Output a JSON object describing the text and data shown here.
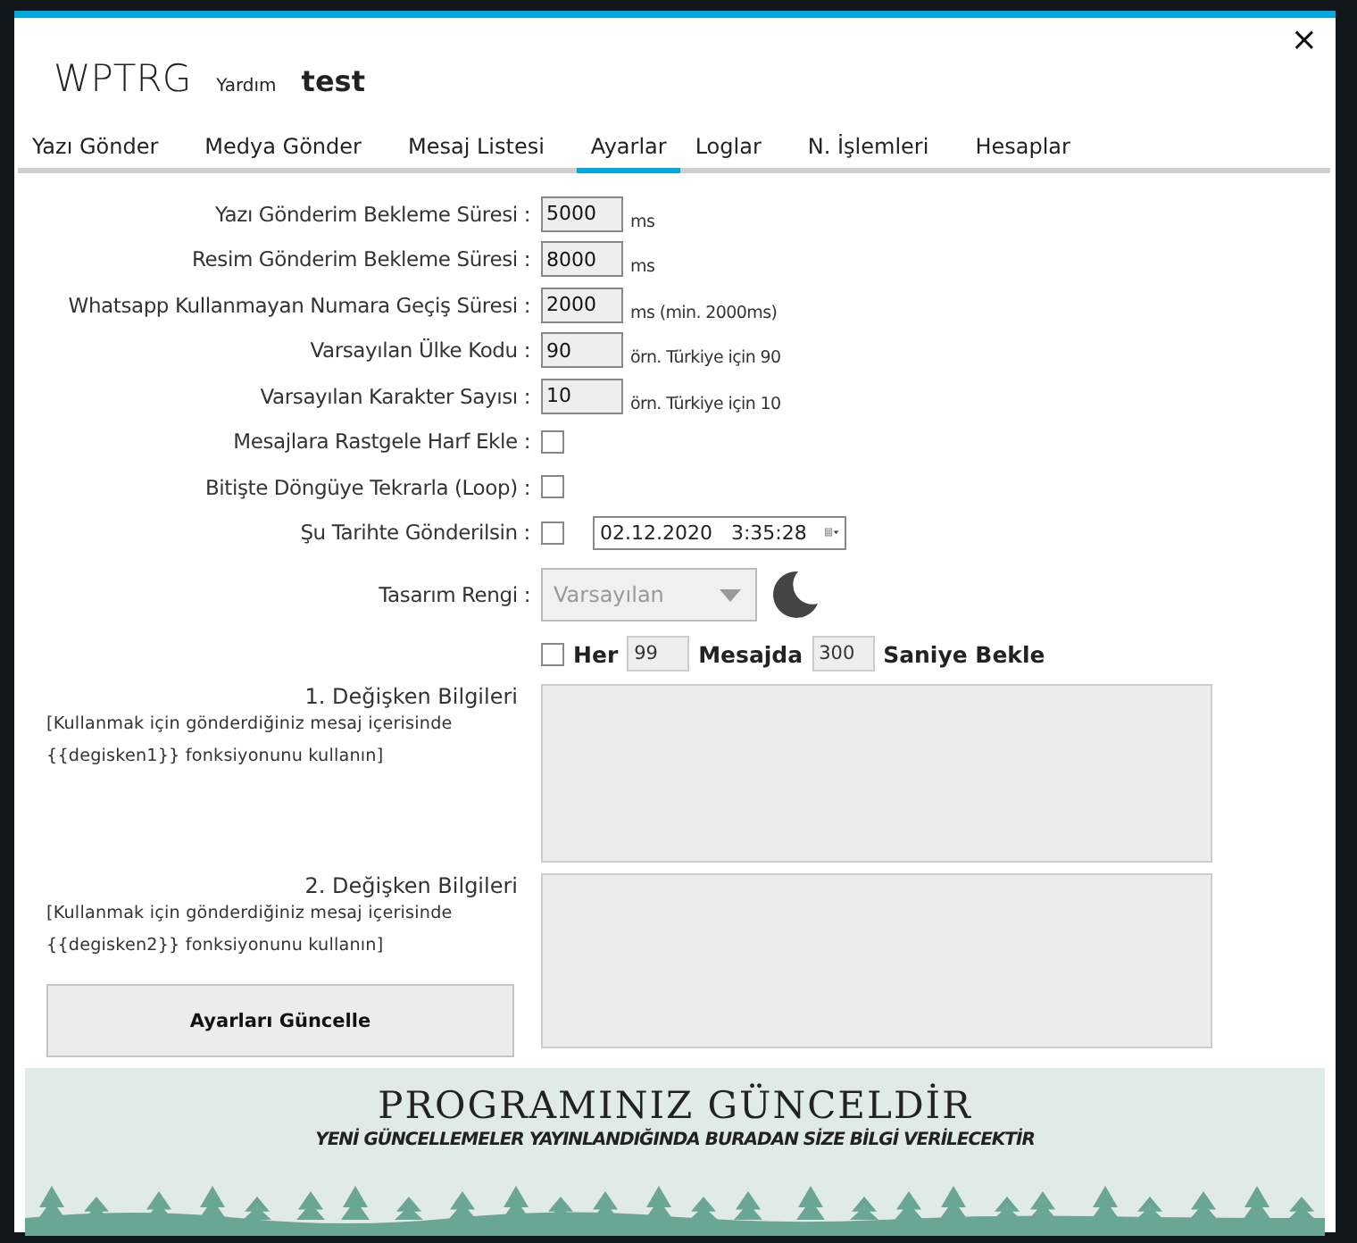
{
  "window": {
    "close": "×"
  },
  "header": {
    "title": "WPTRG",
    "help": "Yardım",
    "user": "test"
  },
  "tabs": [
    {
      "label": "Yazı Gönder",
      "selected": false
    },
    {
      "label": "Medya Gönder",
      "selected": false
    },
    {
      "label": "Mesaj Listesi",
      "selected": false
    },
    {
      "label": "Ayarlar",
      "selected": true
    },
    {
      "label": "Loglar",
      "selected": false
    },
    {
      "label": "N. İşlemleri",
      "selected": false
    },
    {
      "label": "Hesaplar",
      "selected": false
    }
  ],
  "settings": [
    {
      "kind": "number",
      "label": "Yazı Gönderim Bekleme Süresi :",
      "value": "5000",
      "note": "ms"
    },
    {
      "kind": "number",
      "label": "Resim Gönderim Bekleme Süresi :",
      "value": "8000",
      "note": "ms"
    },
    {
      "kind": "number",
      "label": "Whatsapp Kullanmayan Numara Geçiş Süresi :",
      "value": "2000",
      "note": "ms (min. 2000ms)"
    },
    {
      "kind": "number",
      "label": "Varsayılan Ülke Kodu :",
      "value": "90",
      "note": "örn. Türkiye için 90"
    },
    {
      "kind": "number",
      "label": "Varsayılan Karakter Sayısı :",
      "value": "10",
      "note": "örn. Türkiye için 10"
    },
    {
      "kind": "checkbox",
      "label": "Mesajlara Rastgele Harf Ekle :",
      "checked": false
    },
    {
      "kind": "checkbox",
      "label": "Bitişte Döngüye Tekrarla (Loop) :",
      "checked": false
    },
    {
      "kind": "datetime",
      "label": "Şu Tarihte Gönderilsin :",
      "checked": false,
      "value": "02.12.2020   3:35:28"
    },
    {
      "kind": "select",
      "label": "Tasarım Rengi :",
      "value": "Varsayılan",
      "disabled": true
    }
  ],
  "wait_rule": {
    "checked": false,
    "every": "Her",
    "count": "99",
    "per": "Mesajda",
    "seconds": "300",
    "unit": "Saniye Bekle"
  },
  "variables": [
    {
      "title": "1. Değişken Bilgileri",
      "hint": "[Kullanmak için gönderdiğiniz mesaj içerisinde {{degisken1}} fonksiyonunu kullanın]"
    },
    {
      "title": "2. Değişken Bilgileri",
      "hint": "[Kullanmak için gönderdiğiniz mesaj içerisinde {{degisken2}} fonksiyonunu kullanın]"
    }
  ],
  "update_button": "Ayarları Güncelle",
  "banner": {
    "title": "PROGRAMINIZ GÜNCELDİR",
    "subtitle": "YENİ GÜNCELLEMELER YAYINLANDIĞINDA BURADAN SİZE BİLGİ VERİLECEKTİR"
  }
}
